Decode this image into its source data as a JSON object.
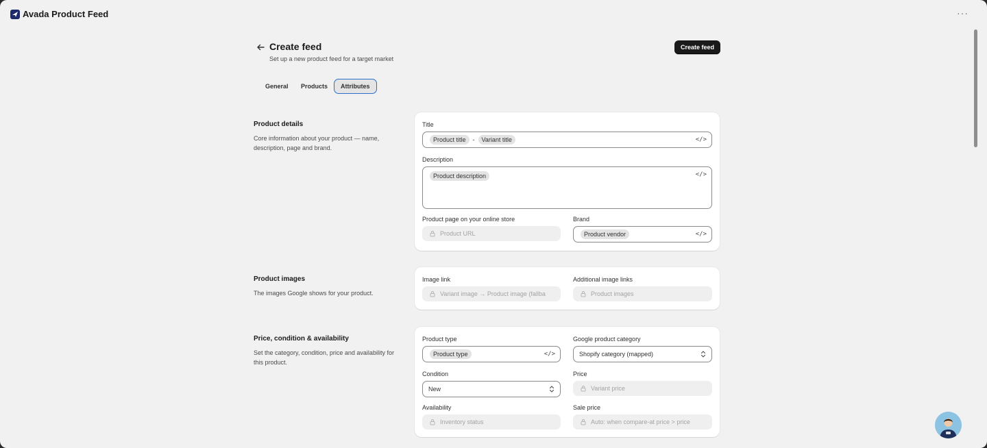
{
  "app": {
    "title": "Avada Product Feed"
  },
  "header": {
    "title": "Create feed",
    "subtitle": "Set up a new product feed for a target market",
    "primary_action": "Create feed"
  },
  "tabs": [
    {
      "label": "General",
      "active": false
    },
    {
      "label": "Products",
      "active": false
    },
    {
      "label": "Attributes",
      "active": true
    }
  ],
  "sections": {
    "details": {
      "title": "Product details",
      "description": "Core information about your product — name, description, page and brand.",
      "title_field": {
        "label": "Title",
        "chips": [
          "Product title",
          "Variant title"
        ],
        "separator": "-"
      },
      "description_field": {
        "label": "Description",
        "chips": [
          "Product description"
        ]
      },
      "page_field": {
        "label": "Product page on your online store",
        "value": "Product URL"
      },
      "brand_field": {
        "label": "Brand",
        "chips": [
          "Product vendor"
        ]
      }
    },
    "images": {
      "title": "Product images",
      "description": "The images Google shows for your product.",
      "image_link": {
        "label": "Image link",
        "value": "Variant image → Product image (fallba"
      },
      "additional_links": {
        "label": "Additional image links",
        "value": "Product images"
      }
    },
    "pricing": {
      "title": "Price, condition & availability",
      "description": "Set the category, condition, price and availability for this product.",
      "product_type": {
        "label": "Product type",
        "chips": [
          "Product type"
        ]
      },
      "google_category": {
        "label": "Google product category",
        "value": "Shopify category (mapped)"
      },
      "condition": {
        "label": "Condition",
        "value": "New"
      },
      "price": {
        "label": "Price",
        "value": "Variant price"
      },
      "availability": {
        "label": "Availability",
        "value": "Inventory status"
      },
      "sale_price": {
        "label": "Sale price",
        "value": "Auto: when compare-at price > price"
      }
    }
  },
  "icons": {
    "code": "</>",
    "more": "···"
  },
  "colors": {
    "accent": "#2c6ecb",
    "primary_button": "#1a1a1a",
    "background": "#f1f1f1"
  }
}
